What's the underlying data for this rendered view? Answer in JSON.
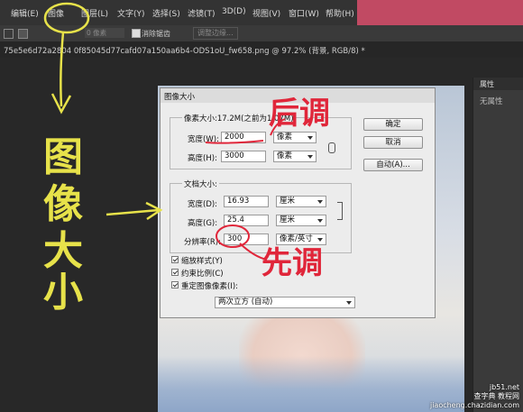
{
  "menubar": {
    "items": [
      "编辑(E)",
      "图像",
      "图层(L)",
      "文字(Y)",
      "选择(S)",
      "滤镜(T)",
      "3D(D)",
      "视图(V)",
      "窗口(W)",
      "帮助(H)"
    ]
  },
  "optionbar": {
    "feather_value": "0 像素",
    "antialias_label": "消除锯齿",
    "adjust_edge_label": "调整边缘..."
  },
  "document": {
    "tab_title": "75e5e6d72a2804 0f85045d77cafd07a150aa6b4-ODS1oU_fw658.png @ 97.2% (背景, RGB/8) *"
  },
  "properties_panel": {
    "tab": "属性",
    "content": "无属性"
  },
  "dialog": {
    "title": "图像大小",
    "pixel_group_label": "像素大小:17.2M(之前为1.07M)",
    "width_label": "宽度(W):",
    "width_value": "2000",
    "width_unit": "像素",
    "height_label": "高度(H):",
    "height_value": "3000",
    "height_unit": "像素",
    "doc_group_label": "文档大小:",
    "doc_width_label": "宽度(D):",
    "doc_width_value": "16.93",
    "doc_width_unit": "厘米",
    "doc_height_label": "高度(G):",
    "doc_height_value": "25.4",
    "doc_height_unit": "厘米",
    "resolution_label": "分辨率(R):",
    "resolution_value": "300",
    "resolution_unit": "像素/英寸",
    "scale_styles": "缩放样式(Y)",
    "constrain_proportions": "约束比例(C)",
    "resample": "重定图像像素(I):",
    "resample_method": "两次立方 (自动)",
    "ok": "确定",
    "cancel": "取消",
    "auto": "自动(A)..."
  },
  "annotations": {
    "vertical_text": [
      "图",
      "像",
      "大",
      "小"
    ],
    "after_adjust": "后调",
    "first_adjust": "先调"
  },
  "watermark": {
    "line1": "jb51.net",
    "line2": "查字典 教程网",
    "line3": "jiaocheng.chazidian.com"
  },
  "colors": {
    "annotation_yellow": "#e7e24a",
    "annotation_red": "#e0263a",
    "menubar_accent": "#c14a63"
  }
}
